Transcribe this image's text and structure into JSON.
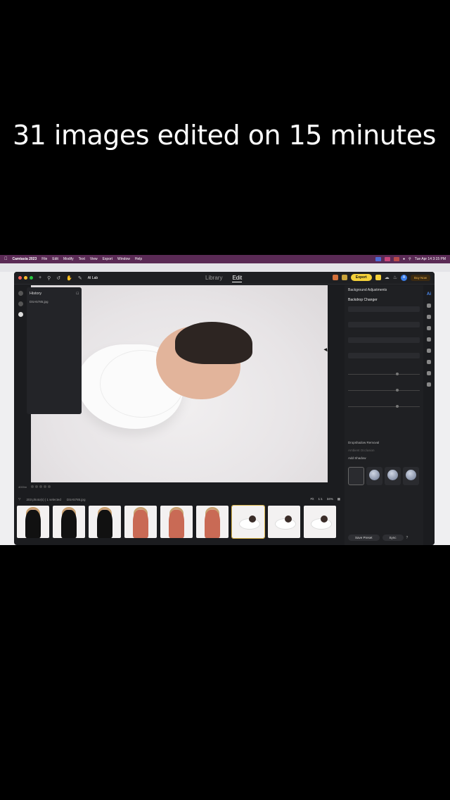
{
  "caption": "31 images edited on 15 minutes",
  "menubar": {
    "app": "Camtasia 2023",
    "items": [
      "File",
      "Edit",
      "Modify",
      "Text",
      "View",
      "Export",
      "Window",
      "Help"
    ],
    "clock": "Tue Apr 14  3:15 PM"
  },
  "app": {
    "toolbar": {
      "ai_lab": "AI Lab",
      "library": "Library",
      "edit": "Edit",
      "export": "Export",
      "buy_now": "Buy Now",
      "avatar": "A"
    },
    "history": {
      "title": "History",
      "item": "DSA5785.jpg"
    },
    "status": {
      "zoom_left": "4000m"
    },
    "filmbar": {
      "info": "203 photo(s) | 1 selected",
      "file": "DSA5785.jpg",
      "fit": "Fit",
      "ratio": "1:1",
      "zoom": "34%"
    },
    "panel": {
      "title": "Background Adjustments",
      "section": "Backdrop Changer",
      "rows": [
        "Dropshadow Removal",
        "Ambient Occlusion",
        "Add Shadow"
      ],
      "save_preset": "Save Preset",
      "sync": "Sync"
    }
  },
  "colors": {
    "accent": "#f5d13a",
    "selection": "#d9b44a",
    "menubar": "#5a2a55"
  }
}
